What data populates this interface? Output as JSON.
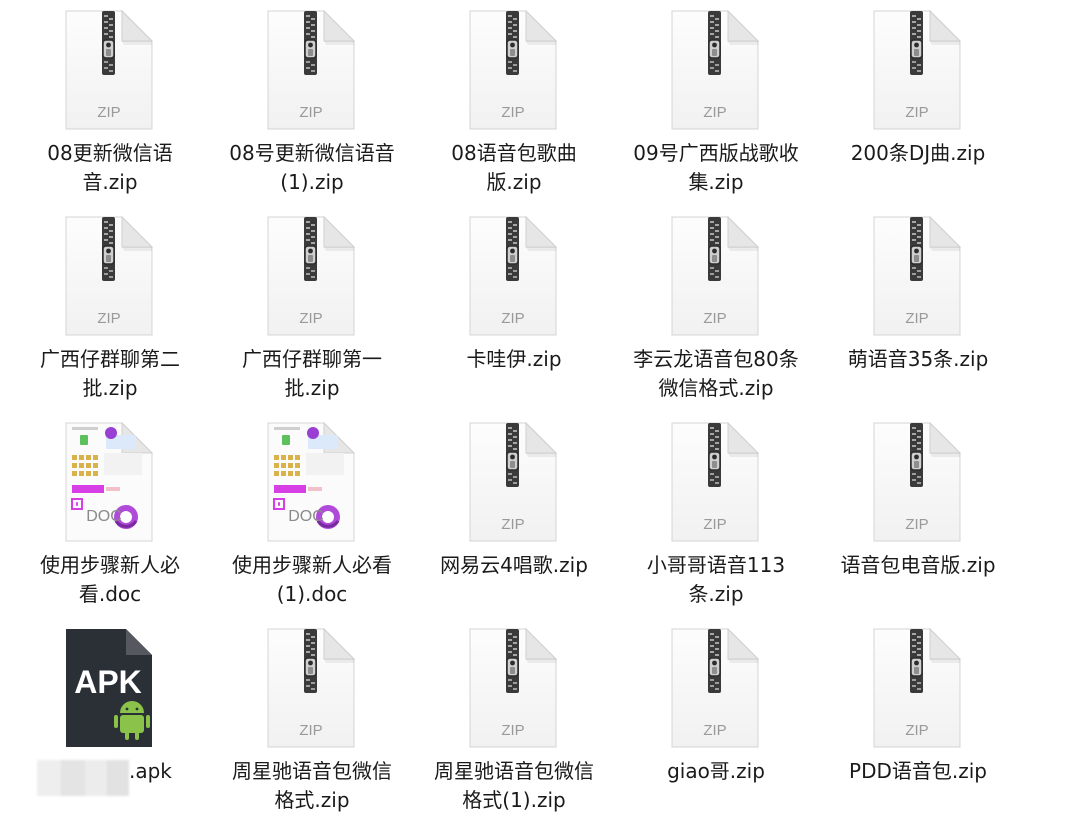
{
  "files": [
    {
      "name": "08更新微信语\n音.zip",
      "type": "zip",
      "kind_label": "ZIP",
      "icon": "zip-file-icon"
    },
    {
      "name": "08号更新微信语音\n(1).zip",
      "type": "zip",
      "kind_label": "ZIP",
      "icon": "zip-file-icon"
    },
    {
      "name": "08语音包歌曲\n版.zip",
      "type": "zip",
      "kind_label": "ZIP",
      "icon": "zip-file-icon"
    },
    {
      "name": "09号广西版战歌收\n集.zip",
      "type": "zip",
      "kind_label": "ZIP",
      "icon": "zip-file-icon"
    },
    {
      "name": "200条DJ曲.zip",
      "type": "zip",
      "kind_label": "ZIP",
      "icon": "zip-file-icon"
    },
    {
      "name": "广西仔群聊第二\n批.zip",
      "type": "zip",
      "kind_label": "ZIP",
      "icon": "zip-file-icon"
    },
    {
      "name": "广西仔群聊第一\n批.zip",
      "type": "zip",
      "kind_label": "ZIP",
      "icon": "zip-file-icon"
    },
    {
      "name": "卡哇伊.zip",
      "type": "zip",
      "kind_label": "ZIP",
      "icon": "zip-file-icon"
    },
    {
      "name": "李云龙语音包80条\n微信格式.zip",
      "type": "zip",
      "kind_label": "ZIP",
      "icon": "zip-file-icon"
    },
    {
      "name": "萌语音35条.zip",
      "type": "zip",
      "kind_label": "ZIP",
      "icon": "zip-file-icon"
    },
    {
      "name": "使用步骤新人必\n看.doc",
      "type": "doc",
      "kind_label": "DOC",
      "icon": "doc-file-icon"
    },
    {
      "name": "使用步骤新人必看\n(1).doc",
      "type": "doc",
      "kind_label": "DOC",
      "icon": "doc-file-icon"
    },
    {
      "name": "网易云4唱歌.zip",
      "type": "zip",
      "kind_label": "ZIP",
      "icon": "zip-file-icon"
    },
    {
      "name": "小哥哥语音113\n条.zip",
      "type": "zip",
      "kind_label": "ZIP",
      "icon": "zip-file-icon"
    },
    {
      "name": "语音包电音版.zip",
      "type": "zip",
      "kind_label": "ZIP",
      "icon": "zip-file-icon"
    },
    {
      "name": ".apk",
      "type": "apk",
      "kind_label": "APK",
      "icon": "apk-file-icon",
      "name_blurred": true
    },
    {
      "name": "周星驰语音包微信\n格式.zip",
      "type": "zip",
      "kind_label": "ZIP",
      "icon": "zip-file-icon"
    },
    {
      "name": "周星驰语音包微信\n格式(1).zip",
      "type": "zip",
      "kind_label": "ZIP",
      "icon": "zip-file-icon"
    },
    {
      "name": "giao哥.zip",
      "type": "zip",
      "kind_label": "ZIP",
      "icon": "zip-file-icon"
    },
    {
      "name": "PDD语音包.zip",
      "type": "zip",
      "kind_label": "ZIP",
      "icon": "zip-file-icon"
    }
  ],
  "colors": {
    "label_text": "#1a1a1a",
    "page_bg": "#ffffff",
    "apk_bg": "#2b3036",
    "android_green": "#8bc34a",
    "doc_accent": "#d63ee6"
  }
}
